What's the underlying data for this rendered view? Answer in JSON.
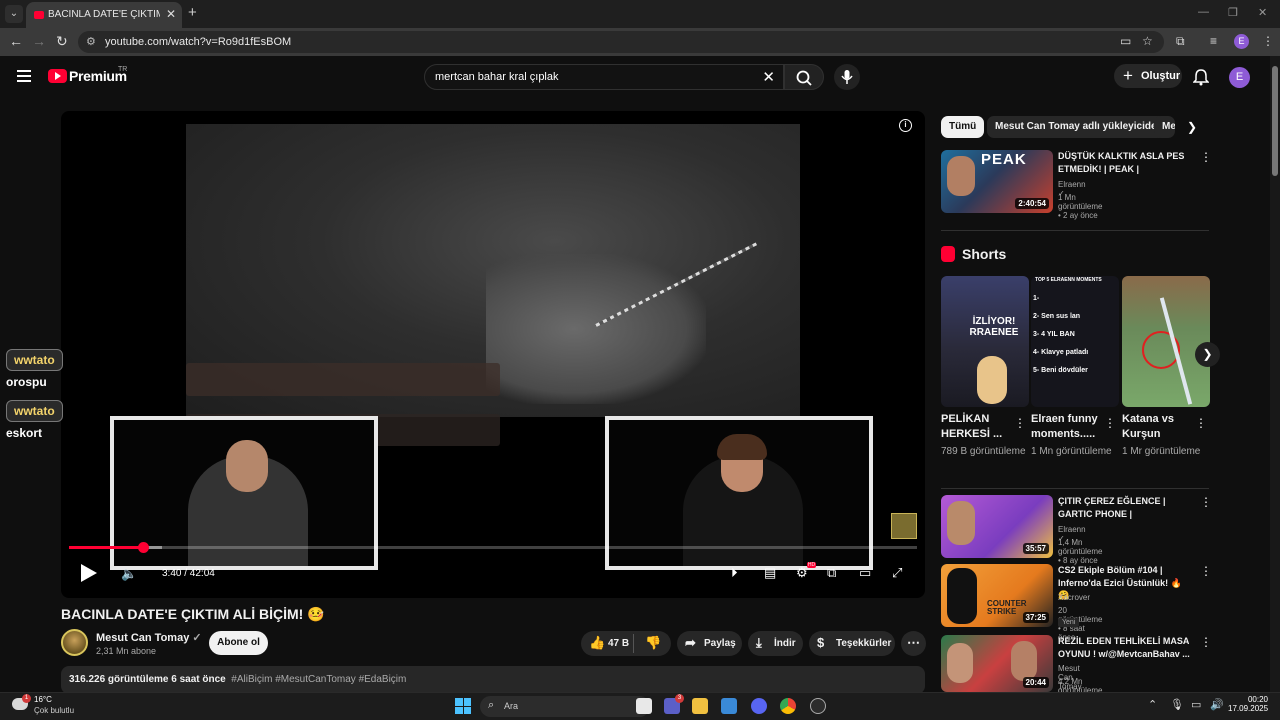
{
  "browser": {
    "tab_title": "BACINLA DATE'E ÇIKTIM ALİ BİÇİM!",
    "tab_close": "✕",
    "new_tab": "+",
    "url": "youtube.com/watch?v=Ro9d1fEsBOM",
    "profile_initial": "E"
  },
  "header": {
    "brand": "Premium",
    "country_code": "TR",
    "search_query": "mertcan bahar kral çıplak",
    "create_label": "Oluştur",
    "avatar_initial": "E"
  },
  "player": {
    "current_time": "3:40",
    "duration": "42:04",
    "time_display": "3:40 / 42:04",
    "progress_fraction": 0.087,
    "buffered_fraction": 0.11,
    "hd_badge": "HD"
  },
  "overlay_chat": [
    {
      "user": "wwtato",
      "message": "orospu"
    },
    {
      "user": "wwtato",
      "message": "eskort"
    }
  ],
  "video": {
    "title": "BACINLA DATE'E ÇIKTIM ALİ BİÇİM! 🤒",
    "channel": "Mesut Can Tomay",
    "subscribers": "2,31 Mn abone",
    "subscribe_label": "Abone ol",
    "likes": "47 B",
    "share_label": "Paylaş",
    "download_label": "İndir",
    "thanks_label": "Teşekkürler",
    "views_time": "316.226 görüntüleme  6 saat önce",
    "tags": "#AliBiçim #MesutCanTomay #EdaBiçim"
  },
  "sidebar": {
    "chips": [
      "Tümü",
      "Mesut Can Tomay adlı yükleyiciden",
      "Me"
    ],
    "top_video": {
      "title": "DÜŞTÜK KALKTIK ASLA PES ETMEDİK! | PEAK |",
      "channel": "Elraenn",
      "meta": "1 Mn görüntüleme • 2 ay önce",
      "duration": "2:40:54",
      "thumb_text": "PEAK"
    },
    "shorts_label": "Shorts",
    "shorts": [
      {
        "title": "PELİKAN HERKESİ ...",
        "views": "789 B görüntüleme",
        "thumb_text": "İZLİYOR! RRAENEE"
      },
      {
        "title": "Elraen funny moments.....",
        "views": "1 Mn görüntüleme",
        "thumb_text": "TOP 5 ELRAENN MOMENTS",
        "list": [
          "1-",
          "2- Sen sus lan",
          "3- 4 YIL BAN",
          "4- Klavye patladı",
          "5- Beni dövdüler"
        ]
      },
      {
        "title": "Katana vs Kurşun",
        "views": "1 Mr görüntüleme"
      }
    ],
    "videos": [
      {
        "title": "ÇITIR ÇEREZ EĞLENCE | GARTIC PHONE |",
        "channel": "Elraenn",
        "meta": "1,4 Mn görüntüleme • 8 ay önce",
        "duration": "35:57",
        "badge": ""
      },
      {
        "title": "CS2 Ekiple Bölüm #104 | Inferno'da Ezici Üstünlük! 🔥🤗",
        "channel": "Xacrover",
        "meta": "20 görüntüleme • 8 saat önce",
        "duration": "37:25",
        "badge": "Yeni",
        "thumb_text": "COUNTER STRIKE"
      },
      {
        "title": "REZİL EDEN TEHLİKELİ MASA OYUNU ! w/@MevtcanBahav ...",
        "channel": "Mesut Can Tomay",
        "meta": "4,2 Mn görüntüleme • 2 yıl önce",
        "duration": "20:44",
        "badge": ""
      }
    ]
  },
  "taskbar": {
    "temperature": "16°C",
    "condition": "Çok bulutlu",
    "weather_badge": "1",
    "search_label": "Ara",
    "time": "00:20",
    "date": "17.09.2025",
    "teams_badge": "3"
  },
  "colors": {
    "accent": "#ff0033",
    "background": "#0f0f0f",
    "surface": "#272727"
  }
}
